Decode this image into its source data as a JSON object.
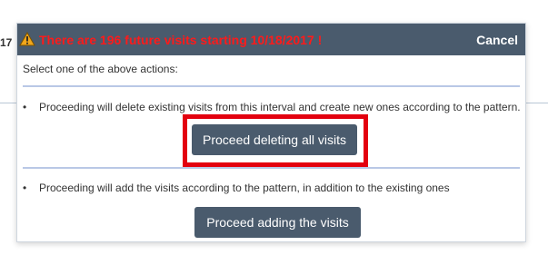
{
  "background": {
    "fragment_text": "17"
  },
  "dialog": {
    "title": "There are 196 future visits starting 10/18/2017 !",
    "cancel_label": "Cancel",
    "prompt": "Select one of the above actions:",
    "options": [
      {
        "bullet": "•",
        "description": "Proceeding will delete existing visits from this interval and create new ones according to the pattern.",
        "button_label": "Proceed deleting all visits",
        "highlighted": true
      },
      {
        "bullet": "•",
        "description": "Proceeding will add the visits according to the pattern, in addition to the existing ones",
        "button_label": "Proceed adding the visits",
        "highlighted": false
      }
    ]
  },
  "colors": {
    "header_bg": "#4a5b6d",
    "title_text": "#ff1a1a",
    "button_bg": "#4a5b6d",
    "separator": "#b9c8e6",
    "highlight": "#e3000f",
    "warning_icon": "#f2a71b"
  },
  "icons": {
    "warning": "warning-triangle-icon"
  }
}
